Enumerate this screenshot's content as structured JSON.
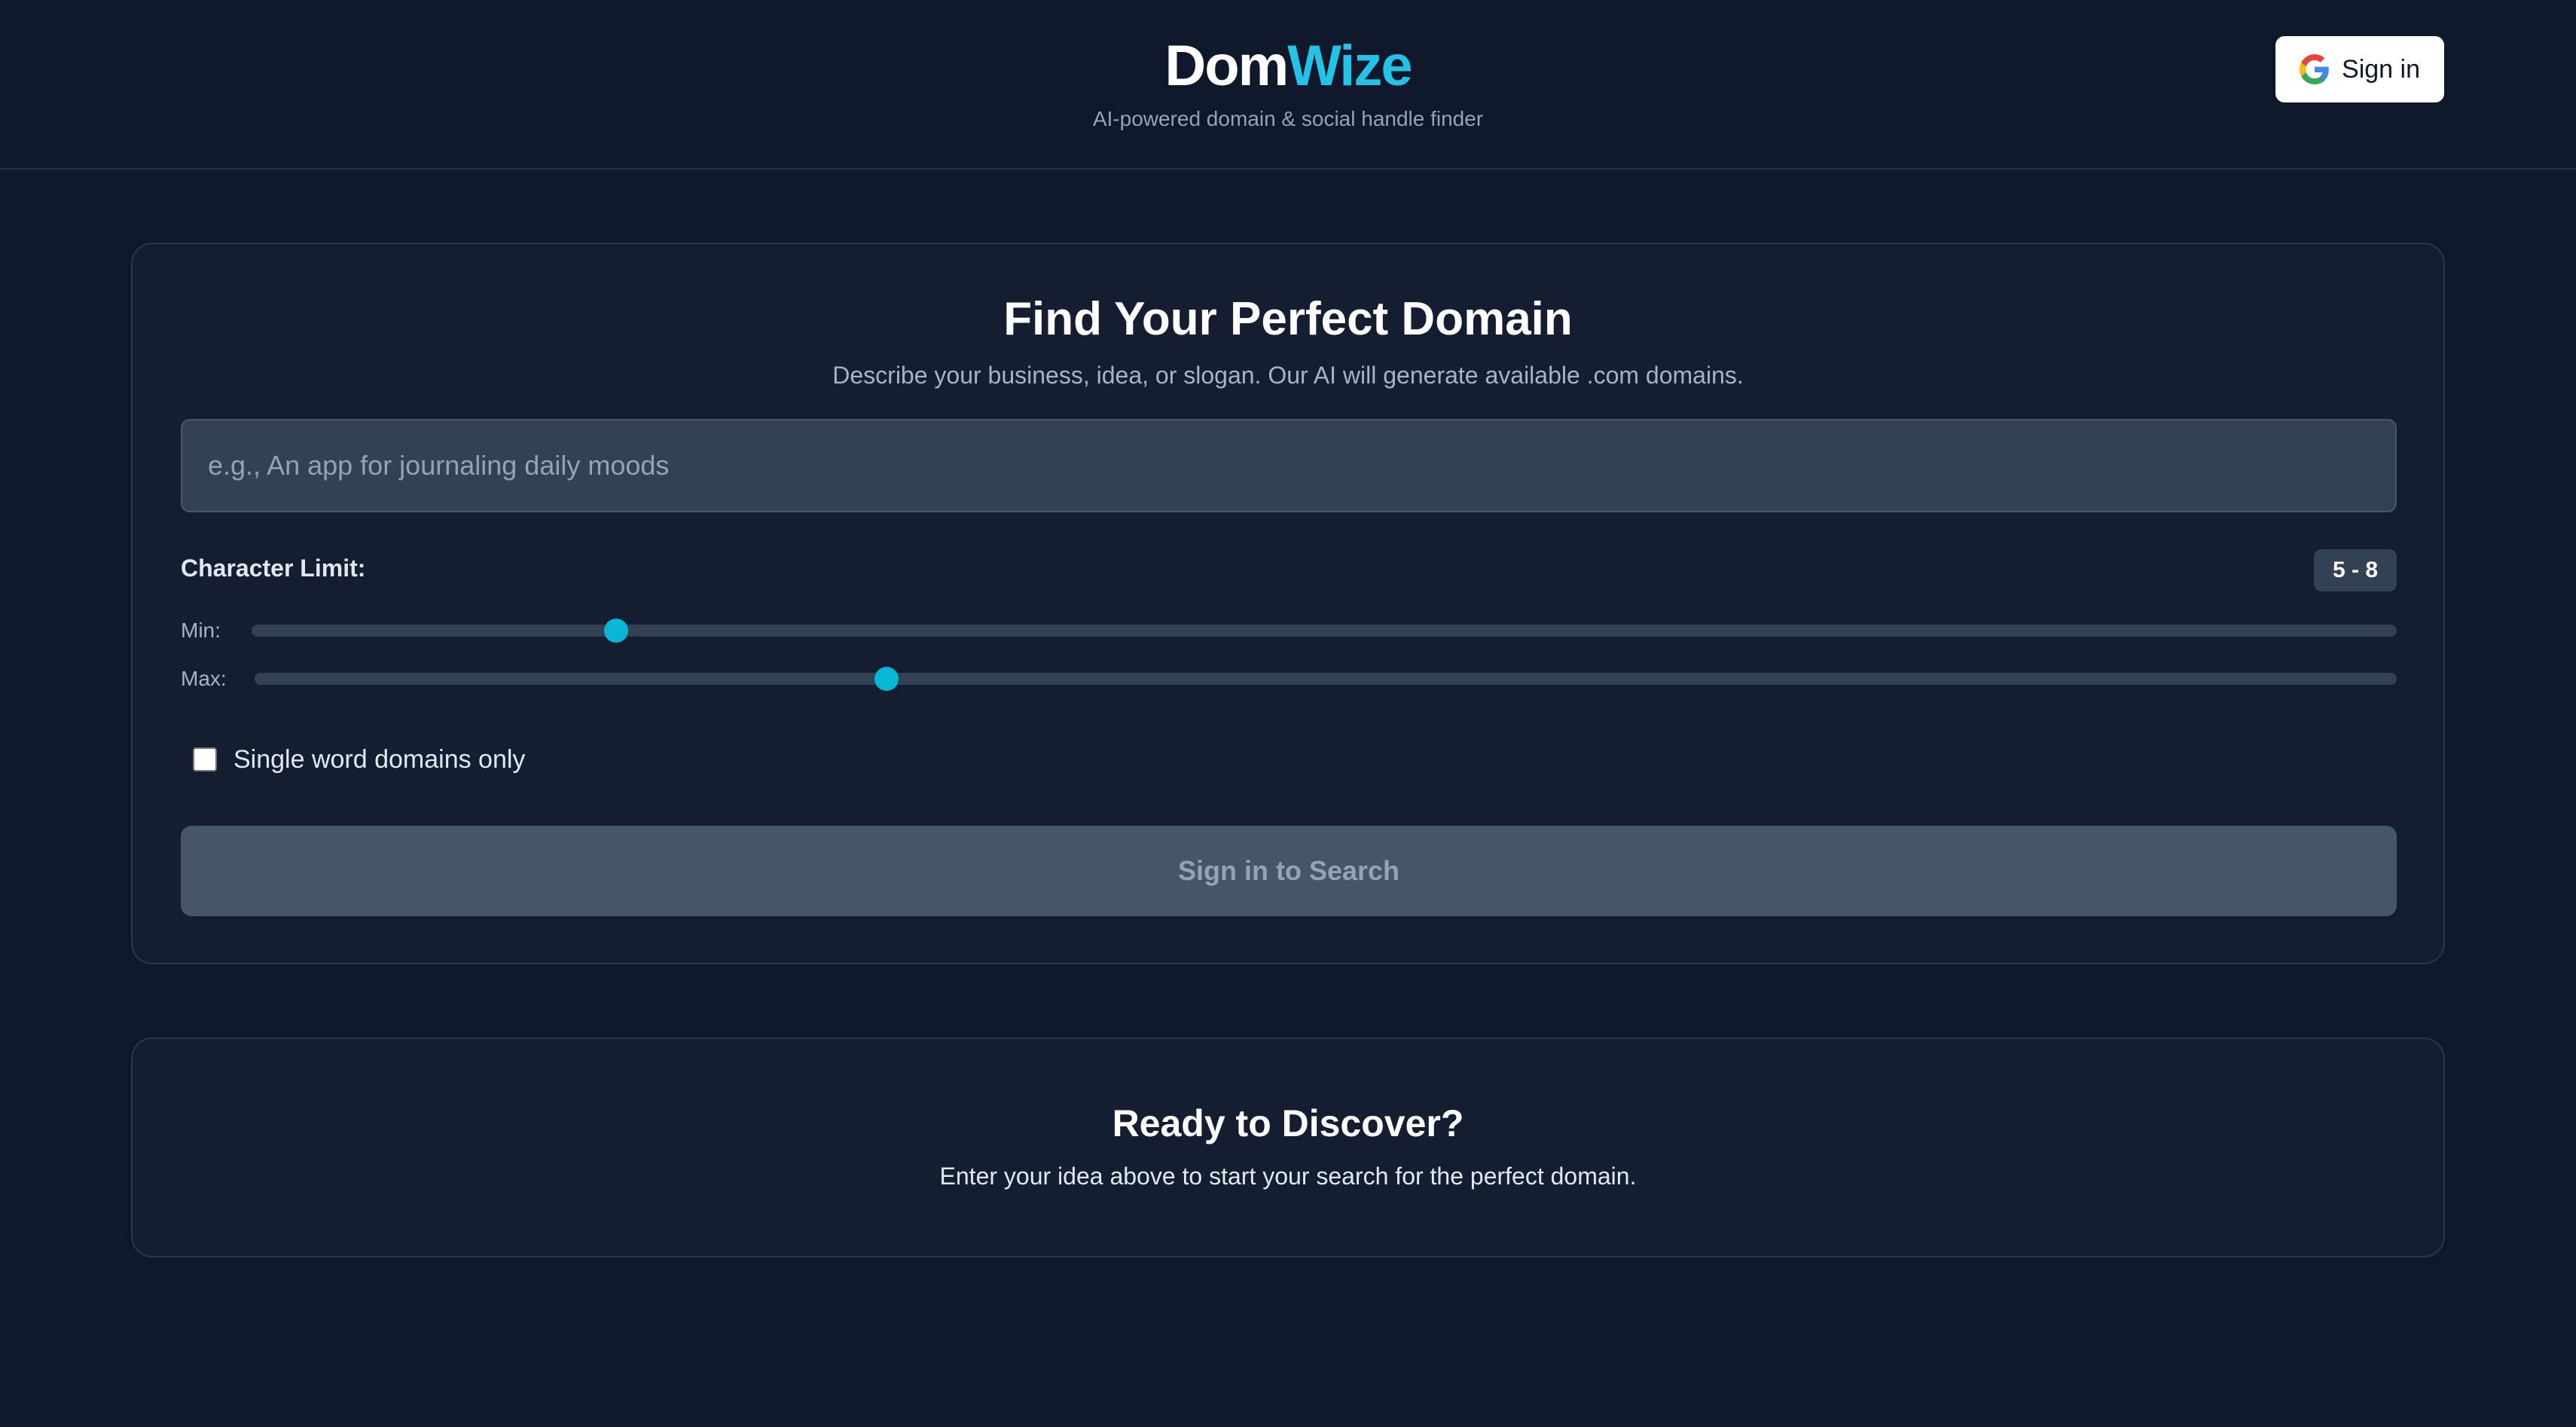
{
  "header": {
    "logo_part1": "Dom",
    "logo_part2": "Wize",
    "tagline": "AI-powered domain & social handle finder",
    "signin_label": "Sign in",
    "signin_icon": "google-icon"
  },
  "search": {
    "title": "Find Your Perfect Domain",
    "subtitle": "Describe your business, idea, or slogan. Our AI will generate available .com domains.",
    "input_placeholder": "e.g., An app for journaling daily moods",
    "input_value": "",
    "char_limit_label": "Character Limit:",
    "char_limit_badge": "5 - 8",
    "min_label": "Min:",
    "max_label": "Max:",
    "min_level": 0.17,
    "max_level": 0.295,
    "single_word_label": "Single word domains only",
    "single_word_checked": false,
    "button_label": "Sign in to Search"
  },
  "ready": {
    "title": "Ready to Discover?",
    "subtitle": "Enter your idea above to start your search for the perfect domain."
  },
  "colors": {
    "background": "#0f172a",
    "card": "#151e30",
    "accent": "#22c3e6",
    "slider_thumb": "#06b6d4",
    "disabled_button": "#475569"
  }
}
